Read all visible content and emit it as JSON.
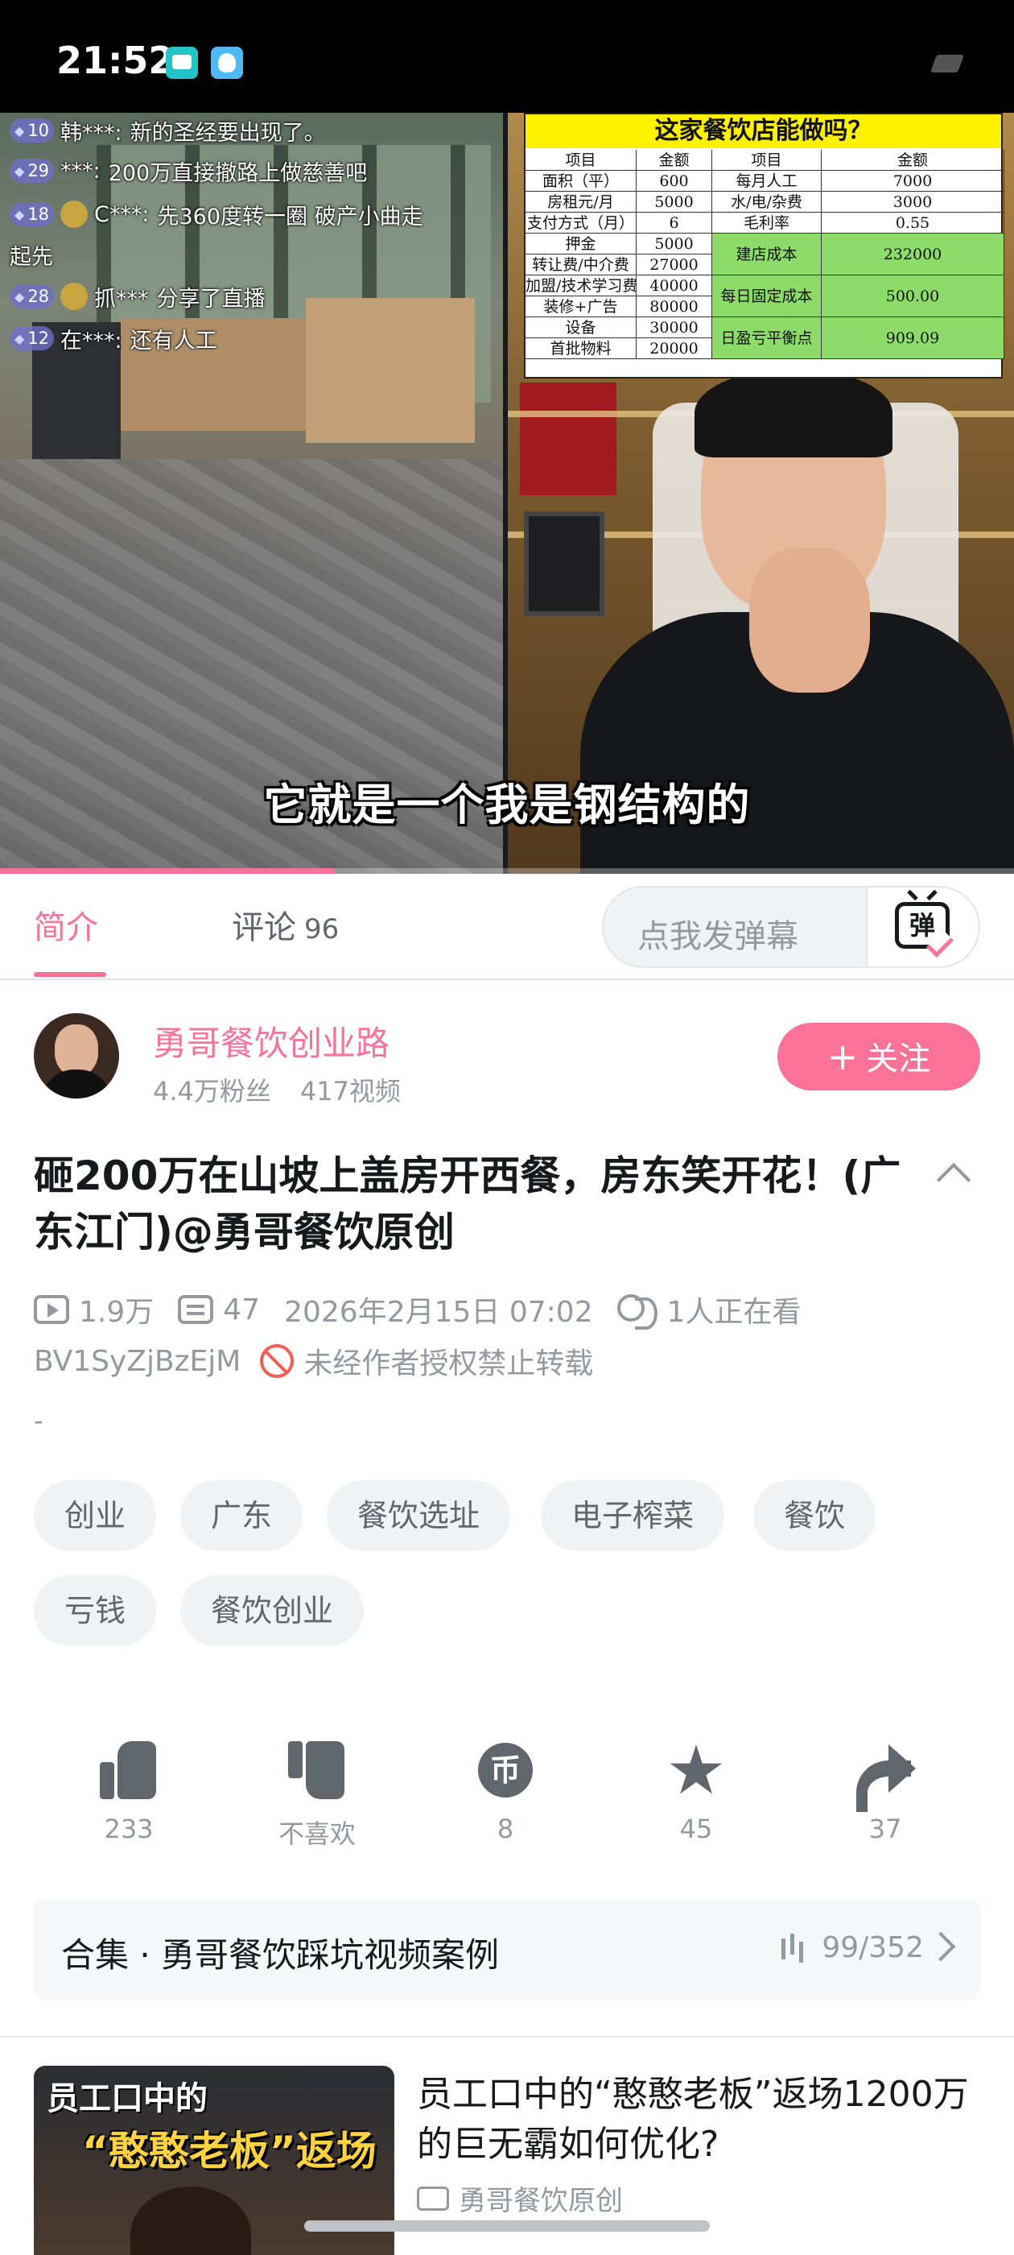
{
  "status_bar": {
    "time": "21:52"
  },
  "video": {
    "danmaku": [
      {
        "level": "10",
        "user": "韩***:",
        "text": "新的圣经要出现了。"
      },
      {
        "level": "29",
        "user": "***:",
        "text": "200万直接撤路上做慈善吧"
      },
      {
        "level": "18",
        "user": "C***:",
        "text": "先360度转一圈 破产小曲走"
      },
      {
        "level": "",
        "user": "",
        "text": "起先"
      },
      {
        "level": "28",
        "user": "抓***",
        "text": "分享了直播"
      },
      {
        "level": "12",
        "user": "在***:",
        "text": "还有人工"
      }
    ],
    "overlay_table": {
      "title": "这家餐饮店能做吗？",
      "left_header": [
        "项目",
        "金额"
      ],
      "left_rows": [
        [
          "面积（平）",
          "600"
        ],
        [
          "房租元/月",
          "5000"
        ],
        [
          "支付方式（月）",
          "6"
        ],
        [
          "押金",
          "5000"
        ],
        [
          "转让费/中介费",
          "27000"
        ],
        [
          "加盟/技术学习费",
          "40000"
        ],
        [
          "装修+广告",
          "80000"
        ],
        [
          "设备",
          "30000"
        ],
        [
          "首批物料",
          "20000"
        ]
      ],
      "right_header": [
        "项目",
        "金额"
      ],
      "right_rows": [
        [
          "每月人工",
          "7000"
        ],
        [
          "水/电/杂费",
          "3000"
        ],
        [
          "毛利率",
          "0.55"
        ]
      ],
      "right_green_rows": [
        [
          "建店成本",
          "232000"
        ],
        [
          "每日固定成本",
          "500.00"
        ],
        [
          "日盈亏平衡点",
          "909.09"
        ]
      ]
    },
    "subtitle": "它就是一个我是钢结构的",
    "progress_fraction": 0.33
  },
  "tabs": {
    "intro": "简介",
    "comments": "评论",
    "comments_count": "96",
    "danmu_placeholder": "点我发弹幕",
    "danmu_icon_text": "弹"
  },
  "uploader": {
    "name": "勇哥餐饮创业路",
    "fans": "4.4万粉丝",
    "videos": "417视频",
    "follow_label": "关注",
    "follow_plus": "+"
  },
  "video_info": {
    "title": "砸200万在山坡上盖房开西餐，房东笑开花！(广东江门)@勇哥餐饮原创",
    "plays": "1.9万",
    "danmaku_count": "47",
    "date": "2026年2月15日 07:02",
    "watching": "1人正在看",
    "bvid": "BV1SyZjBzEjM",
    "copyright": "未经作者授权禁止转载",
    "description": "-"
  },
  "tags": [
    "创业",
    "广东",
    "餐饮选址",
    "电子榨菜",
    "餐饮",
    "亏钱",
    "餐饮创业"
  ],
  "actions": {
    "like": "233",
    "dislike": "不喜欢",
    "coin": "8",
    "favorite": "45",
    "share": "37"
  },
  "collection": {
    "title": "合集 · 勇哥餐饮踩坑视频案例",
    "progress": "99/352"
  },
  "recommended": {
    "thumb_line1": "员工口中的",
    "thumb_line2": "“憨憨老板”返场",
    "title": "员工口中的“憨憨老板”返场1200万的巨无霸如何优化?",
    "uploader": "勇哥餐饮原创"
  },
  "colors": {
    "accent": "#fb7299",
    "muted": "#9499a0",
    "text": "#18191c"
  }
}
